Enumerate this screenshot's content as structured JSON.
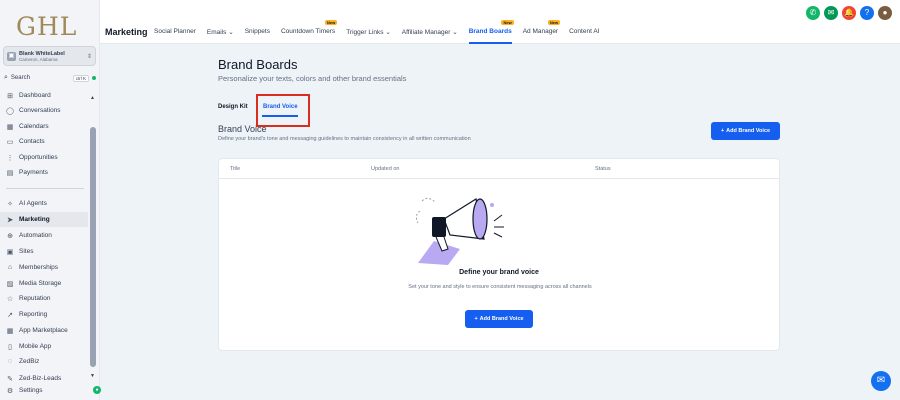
{
  "sidebar": {
    "logo": "GHL",
    "account": {
      "name": "Blank WhiteLabel",
      "sub": "Cameron, Alabama"
    },
    "search": {
      "label": "Search",
      "shortcut": "ctrl K"
    },
    "items": [
      {
        "label": "Dashboard",
        "icon": "dashboard-icon",
        "glyph": "⊞"
      },
      {
        "label": "Conversations",
        "icon": "chat-icon",
        "glyph": "◯"
      },
      {
        "label": "Calendars",
        "icon": "calendar-icon",
        "glyph": "▦"
      },
      {
        "label": "Contacts",
        "icon": "contacts-icon",
        "glyph": "▭"
      },
      {
        "label": "Opportunities",
        "icon": "opportunities-icon",
        "glyph": "⋮"
      },
      {
        "label": "Payments",
        "icon": "payments-icon",
        "glyph": "▤"
      },
      {
        "label": "AI Agents",
        "icon": "ai-agents-icon",
        "glyph": "✧"
      },
      {
        "label": "Marketing",
        "icon": "marketing-icon",
        "glyph": "➤"
      },
      {
        "label": "Automation",
        "icon": "automation-icon",
        "glyph": "⊕"
      },
      {
        "label": "Sites",
        "icon": "sites-icon",
        "glyph": "▣"
      },
      {
        "label": "Memberships",
        "icon": "memberships-icon",
        "glyph": "⌂"
      },
      {
        "label": "Media Storage",
        "icon": "media-icon",
        "glyph": "▨"
      },
      {
        "label": "Reputation",
        "icon": "reputation-icon",
        "glyph": "☆"
      },
      {
        "label": "Reporting",
        "icon": "reporting-icon",
        "glyph": "↗"
      },
      {
        "label": "App Marketplace",
        "icon": "marketplace-icon",
        "glyph": "▦"
      },
      {
        "label": "Mobile App",
        "icon": "mobile-icon",
        "glyph": "▯"
      },
      {
        "label": "ZedBiz",
        "icon": "zedbiz-icon",
        "glyph": "◌"
      },
      {
        "label": "Zed-Biz-Leads",
        "icon": "leads-icon",
        "glyph": "✎"
      },
      {
        "label": "Settings",
        "icon": "settings-icon",
        "glyph": "⚙"
      }
    ]
  },
  "topbar": {
    "title": "Marketing",
    "nav": [
      {
        "label": "Social Planner"
      },
      {
        "label": "Emails ⌄"
      },
      {
        "label": "Snippets"
      },
      {
        "label": "Countdown Timers",
        "badge": "New"
      },
      {
        "label": "Trigger Links ⌄"
      },
      {
        "label": "Affiliate Manager ⌄"
      },
      {
        "label": "Brand Boards",
        "badge": "New",
        "active": true
      },
      {
        "label": "Ad Manager",
        "badge": "New"
      },
      {
        "label": "Content AI"
      }
    ],
    "icons": [
      {
        "name": "phone-icon",
        "glyph": "✆",
        "color": "#12b76a"
      },
      {
        "name": "megaphone-icon",
        "glyph": "✉",
        "color": "#039855"
      },
      {
        "name": "bell-icon",
        "glyph": "🔔",
        "color": "#f04438"
      },
      {
        "name": "help-icon",
        "glyph": "?",
        "color": "#1570ef"
      },
      {
        "name": "avatar",
        "glyph": "●",
        "color": "#7a5c3e"
      }
    ]
  },
  "main": {
    "title": "Brand Boards",
    "subtitle": "Personalize your texts, colors and other brand essentials",
    "tabs": [
      {
        "label": "Design Kit"
      },
      {
        "label": "Brand Voice"
      }
    ],
    "section_title": "Brand Voice",
    "section_desc": "Define your brand's tone and messaging guidelines to maintain consistency in all written communication",
    "add_button": "Add Brand Voice",
    "table_headers": [
      "Title",
      "Updated on",
      "Status"
    ],
    "empty_title": "Define your brand voice",
    "empty_desc": "Set your tone and style to ensure consistent messaging across all channels",
    "empty_button": "Add Brand Voice"
  },
  "colors": {
    "accent": "#155eef",
    "highlight": "#d92d20",
    "illustration": "#b9a9f2"
  }
}
